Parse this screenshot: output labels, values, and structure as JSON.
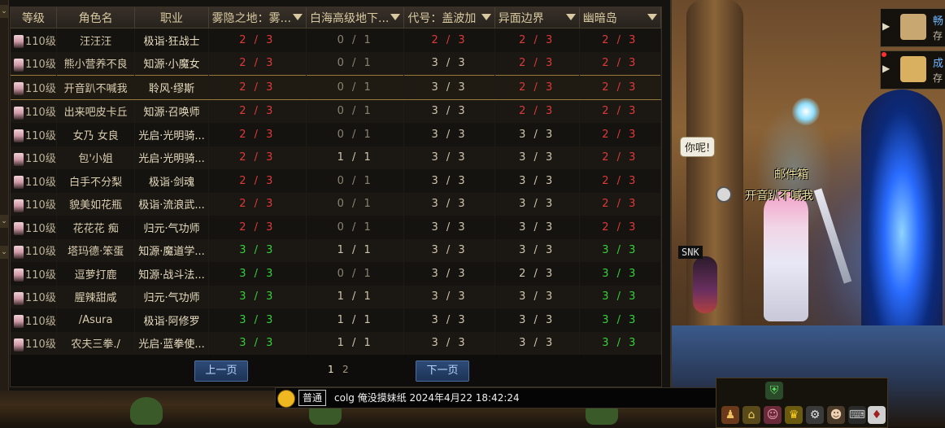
{
  "table": {
    "headers": {
      "level": "等级",
      "name": "角色名",
      "job": "职业",
      "dungeons": [
        "雾隐之地：雾...",
        "白海高级地下...",
        "代号：盖波加",
        "异面边界",
        "幽暗岛"
      ]
    },
    "rows": [
      {
        "level": "110级",
        "name": "汪汪汪",
        "job": "极诣·狂战士",
        "progress": [
          "2 / 3",
          "0 / 1",
          "2 / 3",
          "2 / 3",
          "2 / 3"
        ],
        "status": [
          "red",
          "gray",
          "red",
          "red",
          "red"
        ],
        "selected": false
      },
      {
        "level": "110级",
        "name": "熊小营养不良",
        "job": "知源·小魔女",
        "progress": [
          "2 / 3",
          "0 / 1",
          "3 / 3",
          "2 / 3",
          "2 / 3"
        ],
        "status": [
          "red",
          "gray",
          "light",
          "red",
          "red"
        ],
        "selected": false
      },
      {
        "level": "110级",
        "name": "开音趴不喊我",
        "job": "聆风·缪斯",
        "progress": [
          "2 / 3",
          "0 / 1",
          "3 / 3",
          "2 / 3",
          "2 / 3"
        ],
        "status": [
          "red",
          "gray",
          "light",
          "red",
          "red"
        ],
        "selected": true
      },
      {
        "level": "110级",
        "name": "出来吧皮卡丘",
        "job": "知源·召唤师",
        "progress": [
          "2 / 3",
          "0 / 1",
          "3 / 3",
          "2 / 3",
          "2 / 3"
        ],
        "status": [
          "red",
          "gray",
          "light",
          "red",
          "red"
        ],
        "selected": false
      },
      {
        "level": "110级",
        "name": "女乃  女良",
        "job": "光启·光明骑...",
        "progress": [
          "2 / 3",
          "0 / 1",
          "3 / 3",
          "3 / 3",
          "2 / 3"
        ],
        "status": [
          "red",
          "gray",
          "light",
          "light",
          "red"
        ],
        "selected": false
      },
      {
        "level": "110级",
        "name": "包'小姐",
        "job": "光启·光明骑...",
        "progress": [
          "2 / 3",
          "1 / 1",
          "3 / 3",
          "3 / 3",
          "2 / 3"
        ],
        "status": [
          "red",
          "light",
          "light",
          "light",
          "red"
        ],
        "selected": false
      },
      {
        "level": "110级",
        "name": "白手不分梨",
        "job": "极诣·剑魂",
        "progress": [
          "2 / 3",
          "0 / 1",
          "3 / 3",
          "3 / 3",
          "2 / 3"
        ],
        "status": [
          "red",
          "gray",
          "light",
          "light",
          "red"
        ],
        "selected": false
      },
      {
        "level": "110级",
        "name": "貌美如花瓶",
        "job": "极诣·流浪武...",
        "progress": [
          "2 / 3",
          "0 / 1",
          "3 / 3",
          "3 / 3",
          "2 / 3"
        ],
        "status": [
          "red",
          "gray",
          "light",
          "light",
          "red"
        ],
        "selected": false
      },
      {
        "level": "110级",
        "name": "花花花  痴",
        "job": "归元·气功师",
        "progress": [
          "2 / 3",
          "0 / 1",
          "3 / 3",
          "3 / 3",
          "2 / 3"
        ],
        "status": [
          "red",
          "gray",
          "light",
          "light",
          "red"
        ],
        "selected": false
      },
      {
        "level": "110级",
        "name": "塔玛德·笨蛋",
        "job": "知源·魔道学...",
        "progress": [
          "3 / 3",
          "1 / 1",
          "3 / 3",
          "3 / 3",
          "3 / 3"
        ],
        "status": [
          "green",
          "light",
          "light",
          "light",
          "green"
        ],
        "selected": false
      },
      {
        "level": "110级",
        "name": "逗萝打鹿",
        "job": "知源·战斗法...",
        "progress": [
          "3 / 3",
          "0 / 1",
          "3 / 3",
          "2 / 3",
          "3 / 3"
        ],
        "status": [
          "green",
          "gray",
          "light",
          "light",
          "green"
        ],
        "selected": false
      },
      {
        "level": "110级",
        "name": "腥辣甜咸",
        "job": "归元·气功师",
        "progress": [
          "3 / 3",
          "1 / 1",
          "3 / 3",
          "3 / 3",
          "3 / 3"
        ],
        "status": [
          "green",
          "light",
          "light",
          "light",
          "green"
        ],
        "selected": false
      },
      {
        "level": "110级",
        "name": "/Asura",
        "job": "极诣·阿修罗",
        "progress": [
          "3 / 3",
          "1 / 1",
          "3 / 3",
          "3 / 3",
          "3 / 3"
        ],
        "status": [
          "green",
          "light",
          "light",
          "light",
          "green"
        ],
        "selected": false
      },
      {
        "level": "110级",
        "name": "农夫三拳./",
        "job": "光启·蓝拳使...",
        "progress": [
          "3 / 3",
          "1 / 1",
          "3 / 3",
          "3 / 3",
          "3 / 3"
        ],
        "status": [
          "green",
          "light",
          "light",
          "light",
          "green"
        ],
        "selected": false
      }
    ]
  },
  "pager": {
    "prev_label": "上一页",
    "next_label": "下一页",
    "page1": "1",
    "page2": "2"
  },
  "scene": {
    "speech_bubble": "你呢!",
    "mailbox_label": "邮件箱",
    "player_name": "开音趴不喊我",
    "snk_tag": "SNK"
  },
  "side_panel": {
    "item1_title": "畅",
    "item1_sub": "存",
    "item2_title": "成",
    "item2_sub": "存"
  },
  "chat": {
    "channel": "普通",
    "message": "colg 俺没摸妹纸 2024年4月22 18:42:24"
  },
  "colors": {
    "incomplete": "#e0393a",
    "complete": "#34d03a",
    "disabled": "#8c8473",
    "button": "#2d4b78"
  }
}
